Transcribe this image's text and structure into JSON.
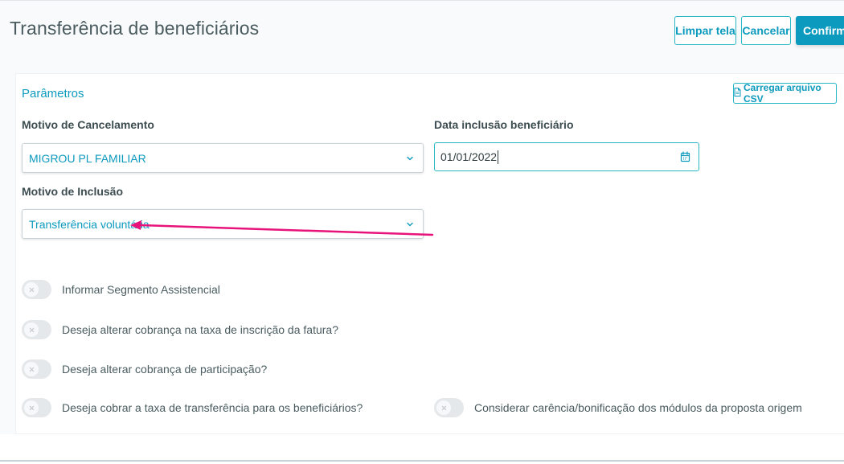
{
  "page": {
    "title": "Transferência de beneficiários"
  },
  "toolbar": {
    "clear_label": "Limpar tela",
    "cancel_label": "Cancelar",
    "confirm_label": "Confirmar"
  },
  "params": {
    "section_title": "Parâmetros",
    "csv_button_label": "Carregar arquivo CSV",
    "csv_icon": "file-icon",
    "motivo_cancelamento": {
      "label": "Motivo de Cancelamento",
      "value": "MIGROU PL FAMILIAR"
    },
    "data_inclusao": {
      "label": "Data inclusão beneficiário",
      "value": "01/01/2022",
      "icon": "calendar-icon"
    },
    "motivo_inclusao": {
      "label": "Motivo de Inclusão",
      "value": "Transferência voluntária"
    }
  },
  "toggles": [
    {
      "label": "Informar Segmento Assistencial",
      "on": false
    },
    {
      "label": "Deseja alterar cobrança na taxa de inscrição da fatura?",
      "on": false
    },
    {
      "label": "Deseja alterar cobrança de participação?",
      "on": false
    },
    {
      "label": "Deseja cobrar a taxa de transferência para os beneficiários?",
      "on": false
    },
    {
      "label": "Considerar carência/bonificação dos módulos da proposta origem",
      "on": false
    }
  ],
  "colors": {
    "accent": "#0c9abe",
    "border_accent": "#29b6c5",
    "annotation_arrow": "#e8137a",
    "toggle_off": "#e5e8ea"
  }
}
